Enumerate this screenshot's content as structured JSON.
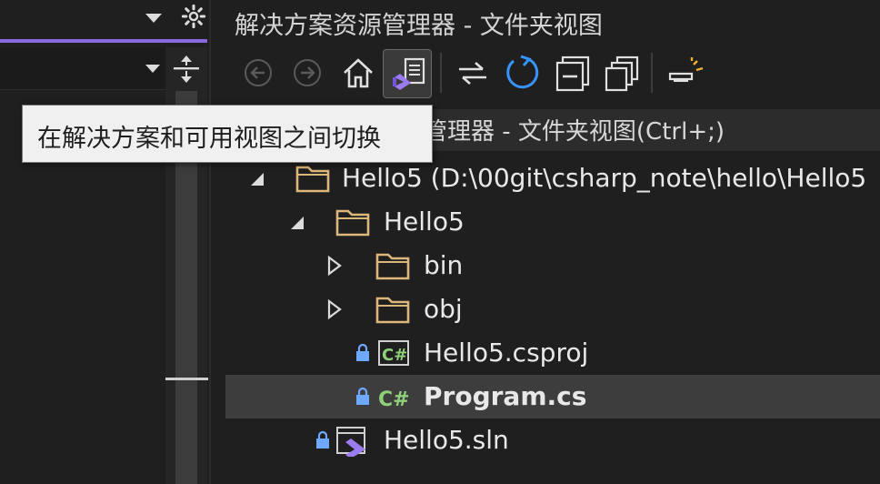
{
  "window_title": "解决方案资源管理器 - 文件夹视图",
  "search": {
    "placeholder_visible": "源管理器 - 文件夹视图(Ctrl+;)"
  },
  "tooltip": {
    "text": "在解决方案和可用视图之间切换"
  },
  "toolbar": {
    "buttons": [
      {
        "icon": "back-icon"
      },
      {
        "icon": "forward-icon"
      },
      {
        "icon": "home-icon"
      },
      {
        "icon": "switch-views-icon",
        "active": true
      },
      {
        "icon": "sync-icon"
      },
      {
        "icon": "refresh-icon"
      },
      {
        "icon": "collapse-all-icon"
      },
      {
        "icon": "copy-icon"
      },
      {
        "icon": "preview-icon"
      }
    ]
  },
  "tree": {
    "items": [
      {
        "label": "Hello5 (D:\\00git\\csharp_note\\hello\\Hello5",
        "kind": "folder",
        "expanded": true,
        "depth": 0
      },
      {
        "label": "Hello5",
        "kind": "folder",
        "expanded": true,
        "depth": 1
      },
      {
        "label": "bin",
        "kind": "folder",
        "expanded": false,
        "depth": 2
      },
      {
        "label": "obj",
        "kind": "folder",
        "expanded": false,
        "depth": 2
      },
      {
        "label": "Hello5.csproj",
        "kind": "csproj",
        "locked": true,
        "depth": 2
      },
      {
        "label": "Program.cs",
        "kind": "cs",
        "locked": true,
        "selected": true,
        "bold": true,
        "depth": 2
      },
      {
        "label": "Hello5.sln",
        "kind": "sln",
        "locked": true,
        "depth": 1
      }
    ]
  },
  "colors": {
    "background": "#1f1f1f",
    "accent": "#8a68e0",
    "folder": "#dcb67a",
    "refresh": "#3794ff",
    "csharp": "#8fd17b",
    "lock": "#6fa8ff",
    "tooltip_bg": "#f0f0f0"
  }
}
